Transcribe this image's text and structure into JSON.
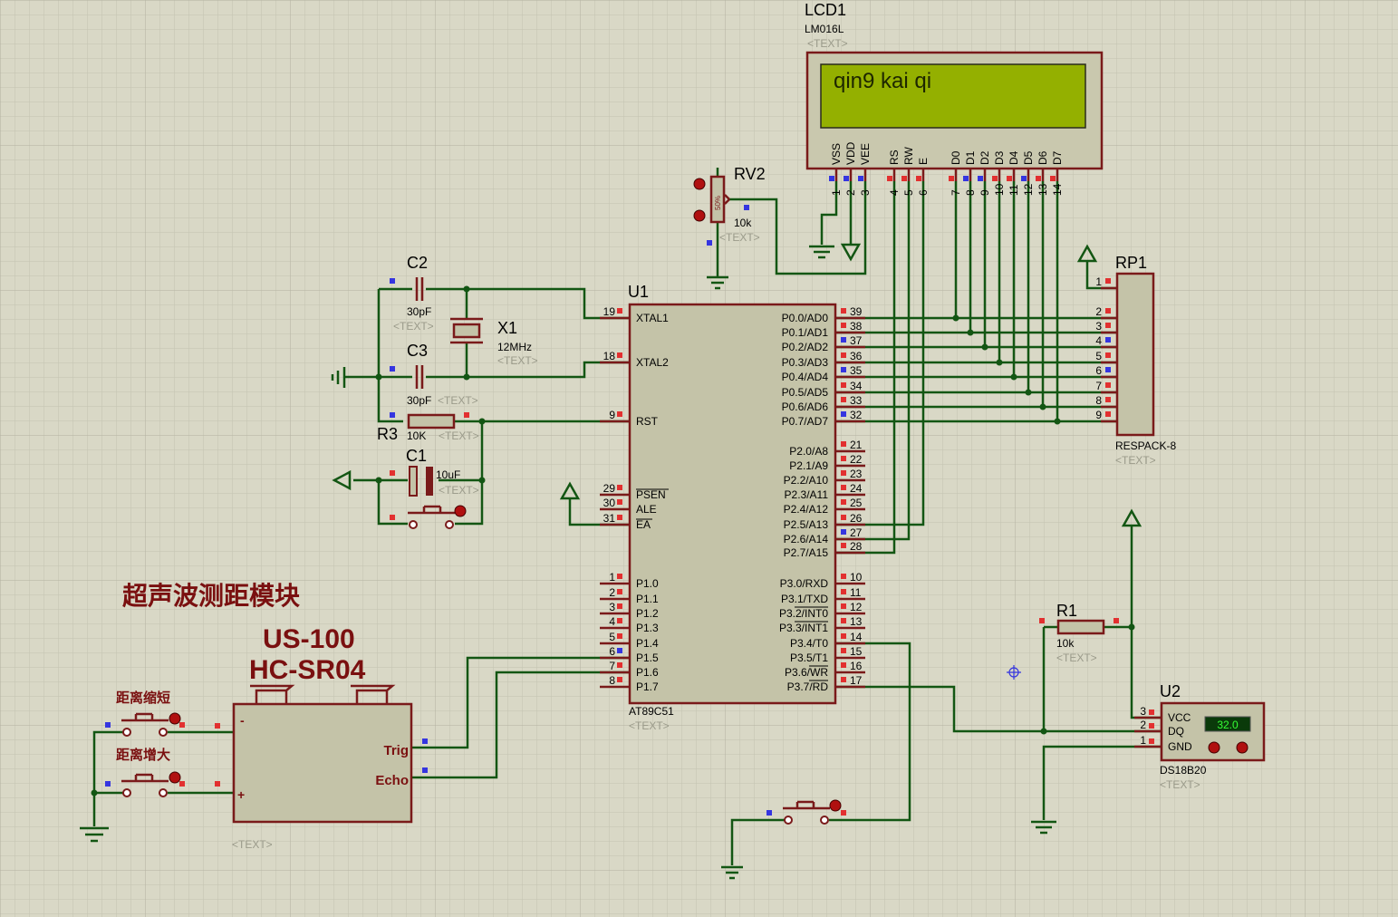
{
  "lcd": {
    "ref": "LCD1",
    "model": "LM016L",
    "text_tag": "<TEXT>",
    "display": "qin9 kai qi",
    "pins": [
      "VSS",
      "VDD",
      "VEE",
      "RS",
      "RW",
      "E",
      "D0",
      "D1",
      "D2",
      "D3",
      "D4",
      "D5",
      "D6",
      "D7"
    ],
    "pin_numbers": [
      "1",
      "2",
      "3",
      "4",
      "5",
      "6",
      "7",
      "8",
      "9",
      "10",
      "11",
      "12",
      "13",
      "14"
    ],
    "colors": {
      "screen": "#94b000",
      "frame": "#c9c8ae",
      "text": "#1d2600"
    }
  },
  "rv2": {
    "ref": "RV2",
    "value": "10k",
    "text_tag": "<TEXT>",
    "wiper": "50%"
  },
  "u1": {
    "ref": "U1",
    "model": "AT89C51",
    "text_tag": "<TEXT>",
    "left_pins": [
      {
        "num": "19",
        "name": "XTAL1"
      },
      {
        "num": "18",
        "name": "XTAL2"
      },
      {
        "num": "9",
        "name": "RST"
      },
      {
        "num": "29",
        "name": "PSEN"
      },
      {
        "num": "30",
        "name": "ALE"
      },
      {
        "num": "31",
        "name": "EA"
      },
      {
        "num": "1",
        "name": "P1.0"
      },
      {
        "num": "2",
        "name": "P1.1"
      },
      {
        "num": "3",
        "name": "P1.2"
      },
      {
        "num": "4",
        "name": "P1.3"
      },
      {
        "num": "5",
        "name": "P1.4"
      },
      {
        "num": "6",
        "name": "P1.5"
      },
      {
        "num": "7",
        "name": "P1.6"
      },
      {
        "num": "8",
        "name": "P1.7"
      }
    ],
    "right_pins": [
      {
        "num": "39",
        "name": "P0.0/AD0"
      },
      {
        "num": "38",
        "name": "P0.1/AD1"
      },
      {
        "num": "37",
        "name": "P0.2/AD2"
      },
      {
        "num": "36",
        "name": "P0.3/AD3"
      },
      {
        "num": "35",
        "name": "P0.4/AD4"
      },
      {
        "num": "34",
        "name": "P0.5/AD5"
      },
      {
        "num": "33",
        "name": "P0.6/AD6"
      },
      {
        "num": "32",
        "name": "P0.7/AD7"
      },
      {
        "num": "21",
        "name": "P2.0/A8"
      },
      {
        "num": "22",
        "name": "P2.1/A9"
      },
      {
        "num": "23",
        "name": "P2.2/A10"
      },
      {
        "num": "24",
        "name": "P2.3/A11"
      },
      {
        "num": "25",
        "name": "P2.4/A12"
      },
      {
        "num": "26",
        "name": "P2.5/A13"
      },
      {
        "num": "27",
        "name": "P2.6/A14"
      },
      {
        "num": "28",
        "name": "P2.7/A15"
      },
      {
        "num": "10",
        "name": "P3.0/RXD"
      },
      {
        "num": "11",
        "name": "P3.1/TXD"
      },
      {
        "num": "12",
        "name": "P3.2/INT0"
      },
      {
        "num": "13",
        "name": "P3.3/INT1"
      },
      {
        "num": "14",
        "name": "P3.4/T0"
      },
      {
        "num": "15",
        "name": "P3.5/T1"
      },
      {
        "num": "16",
        "name": "P3.6/WR"
      },
      {
        "num": "17",
        "name": "P3.7/RD"
      }
    ]
  },
  "c2": {
    "ref": "C2",
    "value": "30pF",
    "text_tag": "<TEXT>"
  },
  "c3": {
    "ref": "C3",
    "value": "30pF",
    "text_tag": "<TEXT>"
  },
  "x1": {
    "ref": "X1",
    "value": "12MHz",
    "text_tag": "<TEXT>"
  },
  "r3": {
    "ref": "R3",
    "value": "10K",
    "text_tag": "<TEXT>"
  },
  "c1": {
    "ref": "C1",
    "value": "10uF",
    "text_tag": "<TEXT>"
  },
  "rp1": {
    "ref": "RP1",
    "model": "RESPACK-8",
    "text_tag": "<TEXT>",
    "pins": [
      "1",
      "2",
      "3",
      "4",
      "5",
      "6",
      "7",
      "8",
      "9"
    ]
  },
  "r1": {
    "ref": "R1",
    "value": "10k",
    "text_tag": "<TEXT>"
  },
  "u2": {
    "ref": "U2",
    "model": "DS18B20",
    "text_tag": "<TEXT>",
    "reading": "32.0",
    "pins": [
      {
        "num": "3",
        "name": "VCC"
      },
      {
        "num": "2",
        "name": "DQ"
      },
      {
        "num": "1",
        "name": "GND"
      }
    ]
  },
  "ultrasonic": {
    "heading": "超声波测距模块",
    "model1": "US-100",
    "model2": "HC-SR04",
    "text_tag": "<TEXT>",
    "pin_minus": "-",
    "pin_plus": "+",
    "pin_trig": "Trig",
    "pin_echo": "Echo"
  },
  "buttons": {
    "shorten": "距离缩短",
    "increase": "距离增大"
  }
}
